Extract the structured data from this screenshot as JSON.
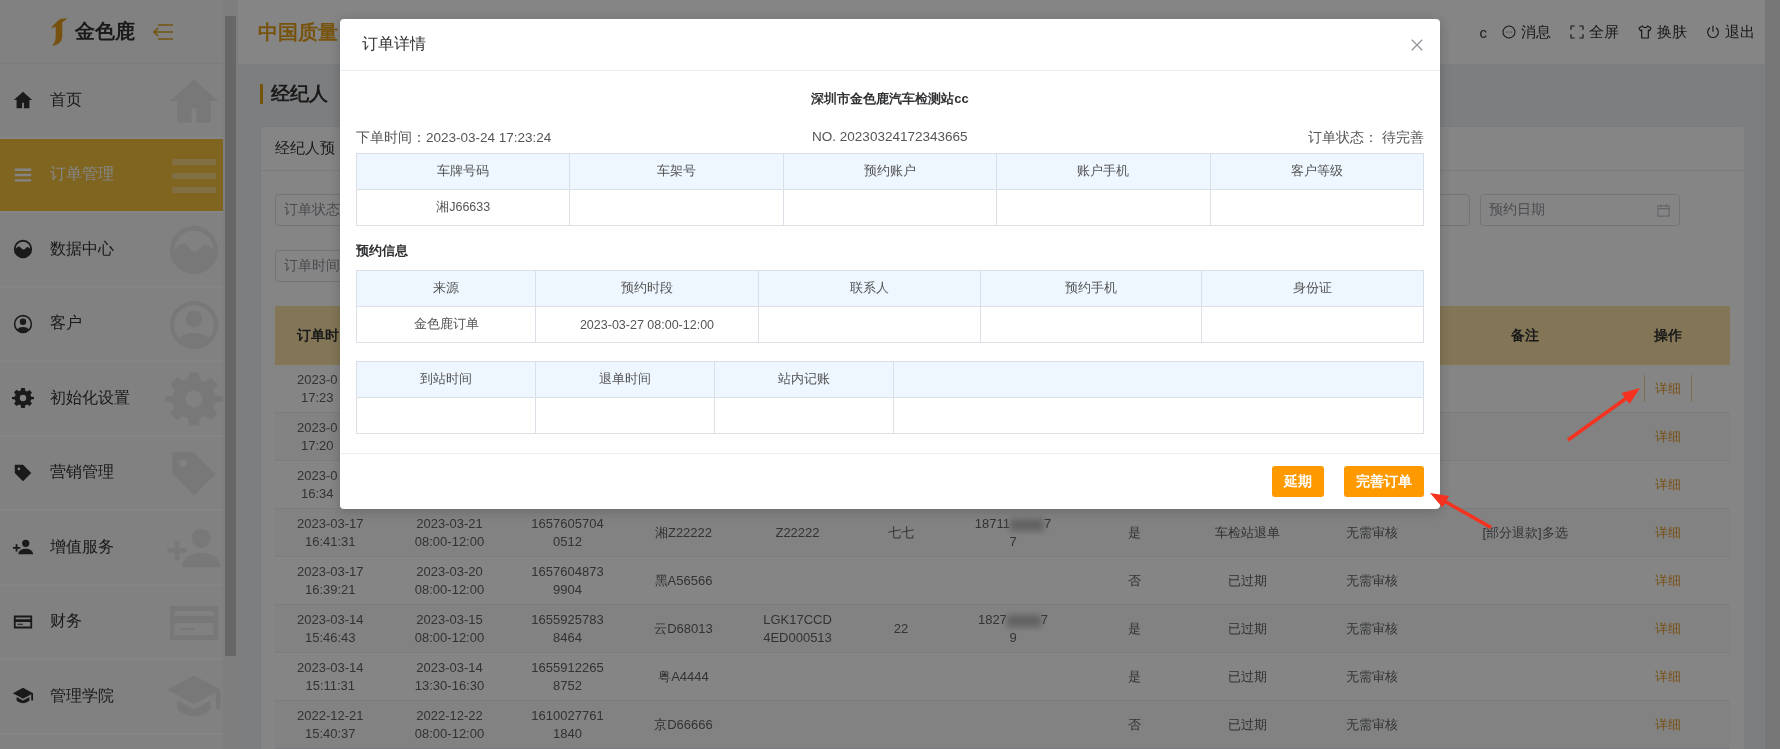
{
  "sidebar": {
    "logo": "金色鹿",
    "items": [
      {
        "label": "首页",
        "selected": false
      },
      {
        "label": "订单管理",
        "selected": true
      },
      {
        "label": "数据中心",
        "selected": false
      },
      {
        "label": "客户",
        "selected": false
      },
      {
        "label": "初始化设置",
        "selected": false
      },
      {
        "label": "营销管理",
        "selected": false
      },
      {
        "label": "增值服务",
        "selected": false
      },
      {
        "label": "财务",
        "selected": false
      },
      {
        "label": "管理学院",
        "selected": false
      }
    ]
  },
  "header": {
    "title": "中国质量",
    "user": "c",
    "actions": [
      "消息",
      "全屏",
      "换肤",
      "退出"
    ]
  },
  "page": {
    "title": "经纪人",
    "tab": "经纪人预",
    "filters": {
      "status_placeholder": "订单状态",
      "time_placeholder": "订单时间",
      "date_placeholder": "预约日期"
    },
    "table": {
      "headings": {
        "time": "订单时",
        "remark": "备注",
        "action": "操作"
      },
      "rows": [
        {
          "time": [
            "2023-0",
            "17:23"
          ],
          "action": "详细",
          "focused": true
        },
        {
          "time": [
            "2023-0",
            "17:20"
          ],
          "action": "详细",
          "focused": false
        },
        {
          "time": [
            "2023-0",
            "16:34"
          ],
          "action": "详细",
          "focused": false
        },
        {
          "time": [
            "2023-03-17",
            "16:41:31"
          ],
          "appointment": [
            "2023-03-21",
            "08:00-12:00"
          ],
          "order_no": [
            "1657605704",
            "0512"
          ],
          "plate": "湘Z22222",
          "vin": "Z22222",
          "name": "七七",
          "phone": {
            "start": "18711",
            "end": "7",
            "line2": "7"
          },
          "arrival": "是",
          "status": "车检站退单",
          "review": "无需审核",
          "remark": "[部分退款]多选",
          "action": "详细",
          "focused": false
        },
        {
          "time": [
            "2023-03-17",
            "16:39:21"
          ],
          "appointment": [
            "2023-03-20",
            "08:00-12:00"
          ],
          "order_no": [
            "1657604873",
            "9904"
          ],
          "plate": "黑A56566",
          "arrival": "否",
          "status": "已过期",
          "review": "无需审核",
          "action": "详细",
          "focused": false
        },
        {
          "time": [
            "2023-03-14",
            "15:46:43"
          ],
          "appointment": [
            "2023-03-15",
            "08:00-12:00"
          ],
          "order_no": [
            "1655925783",
            "8464"
          ],
          "plate": "云D68013",
          "vin": [
            "LGK17CCD",
            "4ED000513"
          ],
          "name": "22",
          "phone": {
            "start": "1827",
            "end": "7",
            "line2": "9"
          },
          "arrival": "是",
          "status": "已过期",
          "review": "无需审核",
          "action": "详细",
          "focused": false
        },
        {
          "time": [
            "2023-03-14",
            "15:11:31"
          ],
          "appointment": [
            "2023-03-14",
            "13:30-16:30"
          ],
          "order_no": [
            "1655912265",
            "8752"
          ],
          "plate": "粤A4444",
          "arrival": "是",
          "status": "已过期",
          "review": "无需审核",
          "action": "详细",
          "focused": false
        },
        {
          "time": [
            "2022-12-21",
            "15:40:37"
          ],
          "appointment": [
            "2022-12-22",
            "08:00-12:00"
          ],
          "order_no": [
            "1610027761",
            "1840"
          ],
          "plate": "京D66666",
          "arrival": "否",
          "status": "已过期",
          "review": "无需审核",
          "action": "详细",
          "focused": false
        }
      ]
    }
  },
  "dialog": {
    "title": "订单详情",
    "station": "深圳市金色鹿汽车检测站cc",
    "order_time": "下单时间：2023-03-24 17:23:24",
    "order_no": "NO. 20230324172343665",
    "order_status": "订单状态： 待完善",
    "vehicle_table": {
      "columns": [
        "车牌号码",
        "车架号",
        "预约账户",
        "账户手机",
        "客户等级"
      ],
      "row": [
        "湘J66633"
      ]
    },
    "section": "预约信息",
    "booking_table": {
      "columns": [
        "来源",
        "预约时段",
        "联系人",
        "预约手机",
        "身份证"
      ],
      "row": [
        "金色鹿订单",
        "2023-03-27 08:00-12:00"
      ]
    },
    "station_table": {
      "columns": [
        "到站时间",
        "退单时间",
        "站内记账"
      ]
    },
    "buttons": [
      "延期",
      "完善订单"
    ]
  }
}
